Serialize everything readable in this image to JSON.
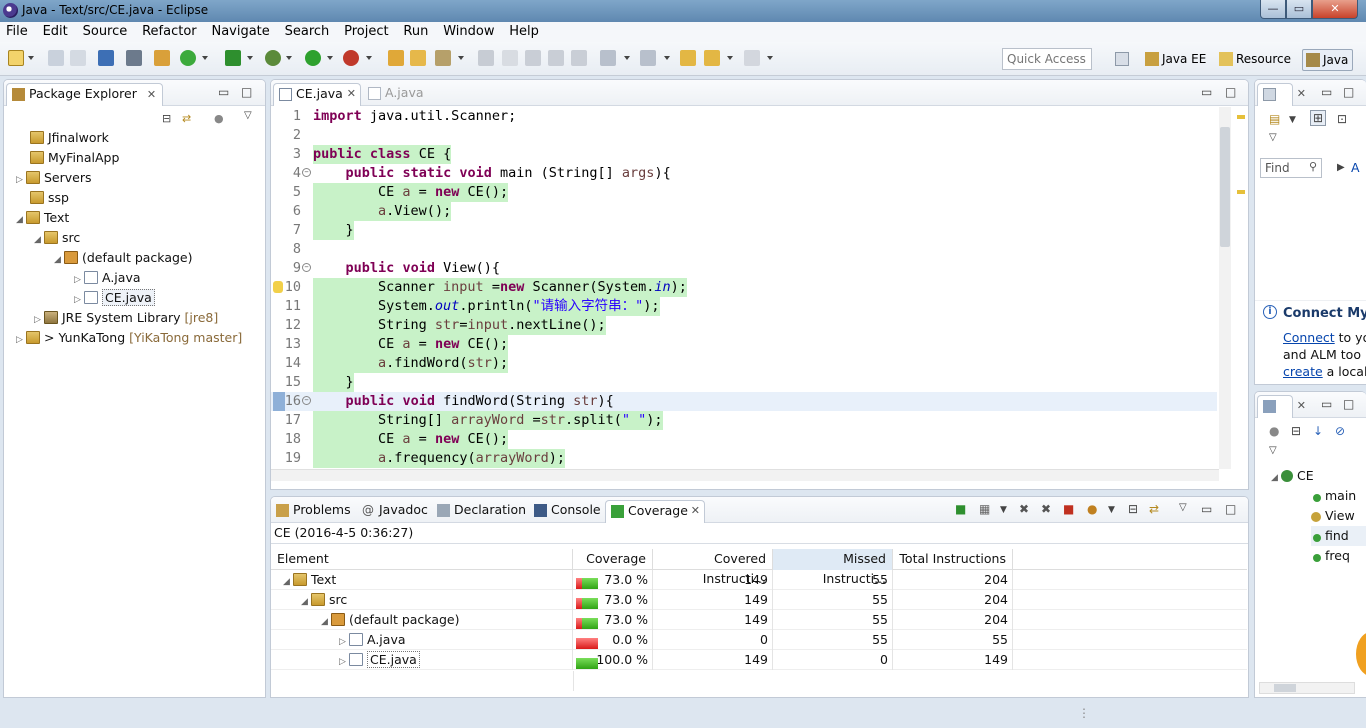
{
  "window": {
    "title": "Java - Text/src/CE.java - Eclipse"
  },
  "menu": [
    "File",
    "Edit",
    "Source",
    "Refactor",
    "Navigate",
    "Search",
    "Project",
    "Run",
    "Window",
    "Help"
  ],
  "toolbar": {
    "quick_access_placeholder": "Quick Access",
    "perspectives": [
      "Java EE",
      "Resource",
      "Java"
    ]
  },
  "package_explorer": {
    "tab": "Package Explorer",
    "items": [
      {
        "label": "Jfinalwork"
      },
      {
        "label": "MyFinalApp"
      },
      {
        "label": "Servers"
      },
      {
        "label": "ssp"
      },
      {
        "label": "Text"
      },
      {
        "label": "src"
      },
      {
        "label": "(default package)"
      },
      {
        "label": "A.java"
      },
      {
        "label": "CE.java"
      },
      {
        "label": "JRE System Library",
        "extra": "[jre8]"
      },
      {
        "label": "> YunKaTong",
        "extra": "[YiKaTong master]"
      }
    ]
  },
  "editor": {
    "tabs": [
      "CE.java",
      "A.java"
    ],
    "lines": [
      {
        "n": "1",
        "t": "import java.util.Scanner;"
      },
      {
        "n": "2",
        "t": ""
      },
      {
        "n": "3",
        "t": "public class CE {"
      },
      {
        "n": "4",
        "t": "    public static void main (String[] args){"
      },
      {
        "n": "5",
        "t": "        CE a = new CE();"
      },
      {
        "n": "6",
        "t": "        a.View();"
      },
      {
        "n": "7",
        "t": "    }"
      },
      {
        "n": "8",
        "t": ""
      },
      {
        "n": "9",
        "t": "    public void View(){"
      },
      {
        "n": "10",
        "t": "        Scanner input =new Scanner(System.in);"
      },
      {
        "n": "11",
        "t": "        System.out.println(\"请输入字符串：\");"
      },
      {
        "n": "12",
        "t": "        String str=input.nextLine();"
      },
      {
        "n": "13",
        "t": "        CE a = new CE();"
      },
      {
        "n": "14",
        "t": "        a.findWord(str);"
      },
      {
        "n": "15",
        "t": "    }"
      },
      {
        "n": "16",
        "t": "    public void findWord(String str){"
      },
      {
        "n": "17",
        "t": "        String[] arrayWord =str.split(\" \");"
      },
      {
        "n": "18",
        "t": "        CE a = new CE();"
      },
      {
        "n": "19",
        "t": "        a.frequency(arrayWord);"
      }
    ]
  },
  "bottom": {
    "tabs": [
      "Problems",
      "Javadoc",
      "Declaration",
      "Console",
      "Coverage"
    ],
    "session": "CE (2016-4-5 0:36:27)",
    "columns": [
      "Element",
      "Coverage",
      "Covered Instructi...",
      "Missed Instructi...",
      "Total Instructions"
    ],
    "rows": [
      {
        "element": "Text",
        "coverage": "73.0 %",
        "ratio": 0.73,
        "covered": "149",
        "missed": "55",
        "total": "204"
      },
      {
        "element": "src",
        "coverage": "73.0 %",
        "ratio": 0.73,
        "covered": "149",
        "missed": "55",
        "total": "204"
      },
      {
        "element": "(default package)",
        "coverage": "73.0 %",
        "ratio": 0.73,
        "covered": "149",
        "missed": "55",
        "total": "204"
      },
      {
        "element": "A.java",
        "coverage": "0.0 %",
        "ratio": 0.0,
        "covered": "0",
        "missed": "55",
        "total": "55"
      },
      {
        "element": "CE.java",
        "coverage": "100.0 %",
        "ratio": 1.0,
        "covered": "149",
        "missed": "0",
        "total": "149"
      }
    ]
  },
  "task_list": {
    "find_placeholder": "Find",
    "all_label": "A"
  },
  "connect": {
    "title": "Connect My",
    "link1": "Connect",
    "text1": " to yo",
    "text2": "and ALM too",
    "link2": "create",
    "text3": " a local"
  },
  "outline": {
    "root": "CE",
    "items": [
      "main",
      "View",
      "find",
      "freq"
    ]
  },
  "colors": {
    "covered": "#2fa314",
    "missed": "#d91a1a",
    "covered_line": "#c8f2c8",
    "keyword": "#7f0055",
    "string": "#2a00ff"
  }
}
